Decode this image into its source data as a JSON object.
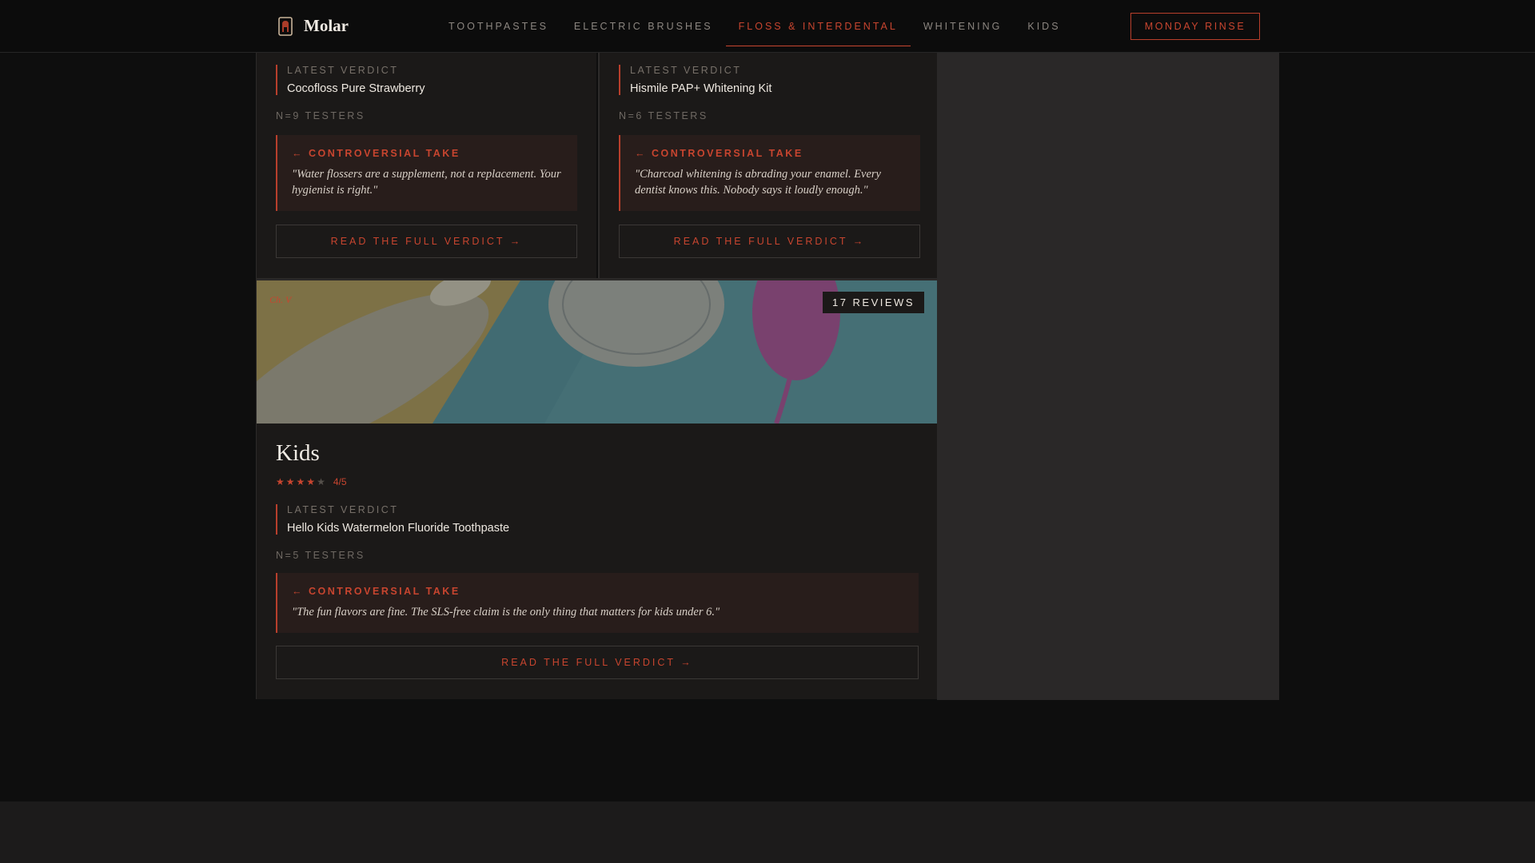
{
  "brand": {
    "name": "Molar",
    "icon": "tooth-icon"
  },
  "nav": {
    "items": [
      {
        "label": "TOOTHPASTES"
      },
      {
        "label": "ELECTRIC BRUSHES"
      },
      {
        "label": "FLOSS & INTERDENTAL"
      },
      {
        "label": "WHITENING"
      },
      {
        "label": "KIDS"
      }
    ],
    "active_index": 2,
    "cta": "MONDAY RINSE"
  },
  "cards": [
    {
      "verdict_label": "LATEST VERDICT",
      "verdict_name": "Cocofloss Pure Strawberry",
      "testers": "N=9 TESTERS",
      "take_head": "CONTROVERSIAL TAKE",
      "take_arrow": "←",
      "take_text": "\"Water flossers are a supplement, not a replacement. Your hygienist is right.\"",
      "read_label": "READ THE FULL VERDICT →"
    },
    {
      "verdict_label": "LATEST VERDICT",
      "verdict_name": "Hismile PAP+ Whitening Kit",
      "testers": "N=6 TESTERS",
      "take_head": "CONTROVERSIAL TAKE",
      "take_arrow": "←",
      "take_text": "\"Charcoal whitening is abrading your enamel. Every dentist knows this. Nobody says it loudly enough.\"",
      "read_label": "READ THE FULL VERDICT →"
    }
  ],
  "kids": {
    "chapter": "Ch. V",
    "reviews": "17 REVIEWS",
    "title": "Kids",
    "rating_value": 4,
    "rating_max": 5,
    "rating_text": "4/5",
    "verdict_label": "LATEST VERDICT",
    "verdict_name": "Hello Kids Watermelon Fluoride Toothpaste",
    "testers": "N=5 TESTERS",
    "take_head": "CONTROVERSIAL TAKE",
    "take_arrow": "←",
    "take_text": "\"The fun flavors are fine. The SLS-free claim is the only thing that matters for kids under 6.\"",
    "read_label": "READ THE FULL VERDICT →"
  },
  "colors": {
    "accent": "#c8452f",
    "background": "#0e0e0e",
    "card": "#1b1918",
    "panel": "#2a2828"
  }
}
